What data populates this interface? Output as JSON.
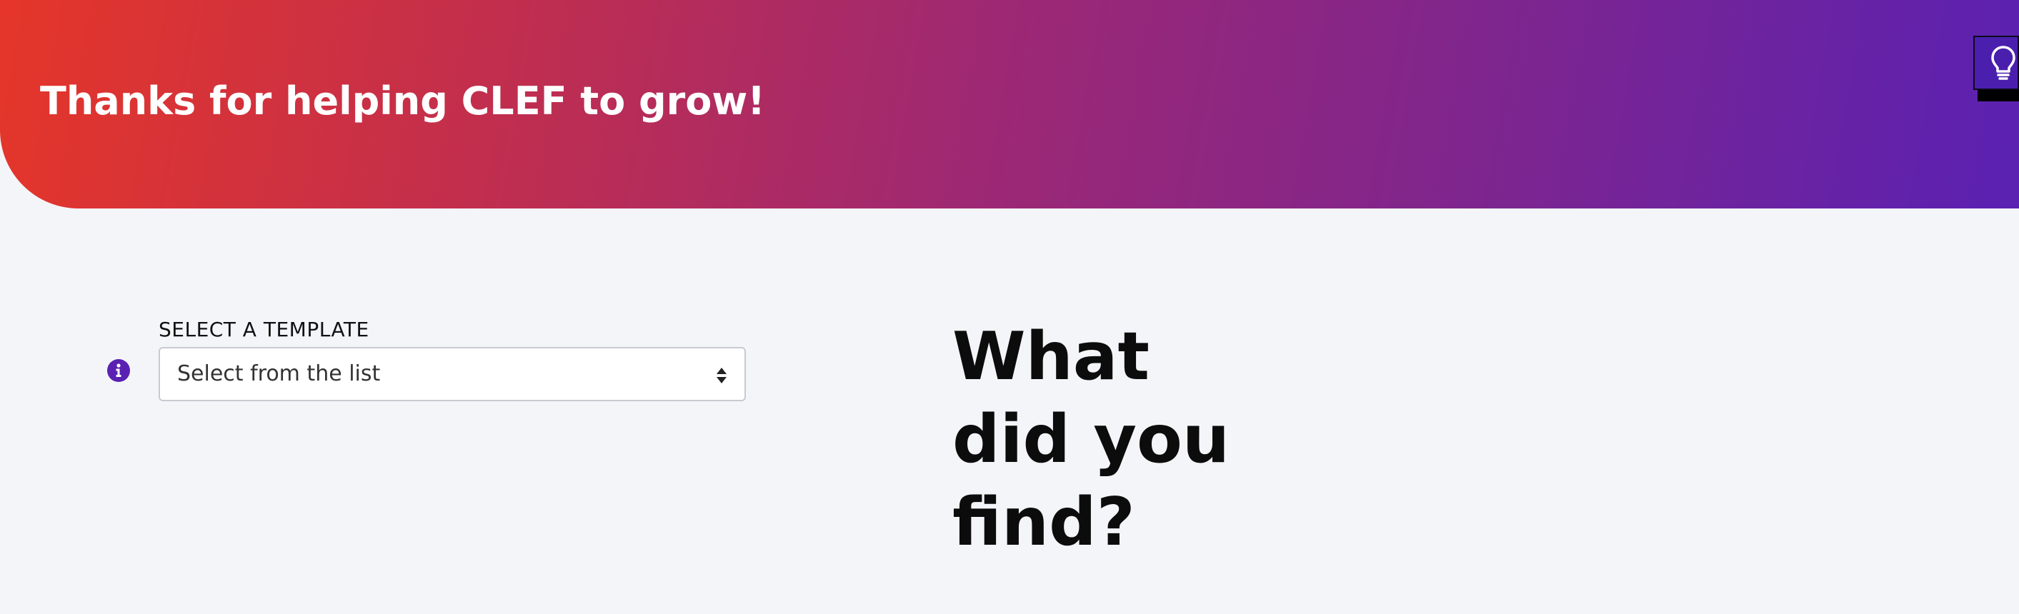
{
  "header": {
    "title": "Thanks for helping CLEF to grow!",
    "tips_icon": "lightbulb-icon"
  },
  "form": {
    "info_icon": "info-icon",
    "template_label": "SELECT A TEMPLATE",
    "template_select": {
      "selected": "Select from the list",
      "caret_icon": "sort-caret-icon"
    }
  },
  "main": {
    "headline_lines": [
      "What",
      "did you",
      "find?"
    ]
  },
  "colors": {
    "gradient_start": "#e53629",
    "gradient_end": "#5a21b2",
    "accent_purple": "#5a21b2",
    "page_background": "#f4f5f9"
  }
}
